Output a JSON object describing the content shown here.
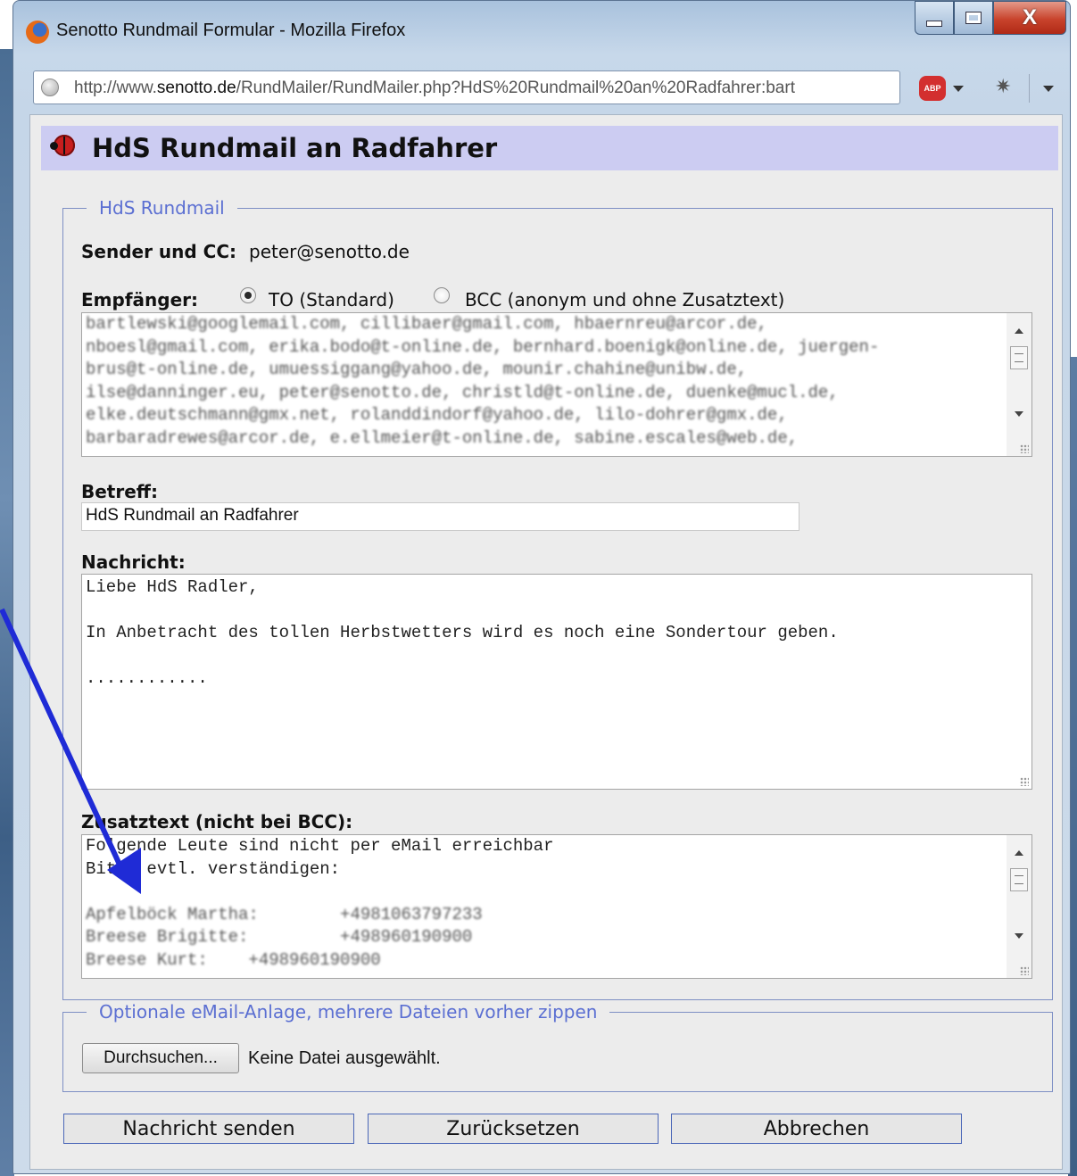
{
  "window": {
    "title": "Senotto Rundmail Formular - Mozilla Firefox",
    "close_label": "X"
  },
  "browser": {
    "url_prefix": "http://www.",
    "url_domain": "senotto.de",
    "url_rest": "/RundMailer/RundMailer.php?HdS%20Rundmail%20an%20Radfahrer:bart",
    "abp_label": "ABP"
  },
  "page": {
    "title": "HdS Rundmail an Radfahrer"
  },
  "form": {
    "legend": "HdS Rundmail",
    "sender_label": "Sender und CC:",
    "sender_value": "peter@senotto.de",
    "recipients_label": "Empfänger:",
    "radio_to_label": "TO (Standard)",
    "radio_bcc_label": "BCC (anonym und ohne Zusatztext)",
    "recipient_mode": "TO",
    "recipients_lines": [
      "bartlewski@googlemail.com, cillibaer@gmail.com, hbaernreu@arcor.de,",
      "nboesl@gmail.com, erika.bodo@t-online.de, bernhard.boenigk@online.de, juergen-",
      "brus@t-online.de, umuessiggang@yahoo.de, mounir.chahine@unibw.de,",
      "ilse@danninger.eu, peter@senotto.de, christld@t-online.de, duenke@mucl.de,",
      "elke.deutschmann@gmx.net, rolanddindorf@yahoo.de, lilo-dohrer@gmx.de,",
      "barbaradrewes@arcor.de, e.ellmeier@t-online.de, sabine.escales@web.de,"
    ],
    "subject_label": "Betreff:",
    "subject_value": "HdS Rundmail an Radfahrer",
    "message_label": "Nachricht:",
    "message_lines": [
      "Liebe HdS Radler,",
      "",
      "In Anbetracht des tollen Herbstwetters wird es noch eine Sondertour geben.",
      "",
      "............"
    ],
    "extra_label": "Zusatztext (nicht bei BCC):",
    "extra_lines": [
      "Folgende Leute sind nicht per eMail erreichbar",
      "Bitte evtl. verständigen:"
    ],
    "extra_blurred_lines": [
      "",
      "Apfelböck Martha:        +4981063797233",
      "Breese Brigitte:         +498960190900",
      "Breese Kurt:    +498960190900"
    ]
  },
  "attachment": {
    "legend": "Optionale eMail-Anlage, mehrere Dateien vorher zippen",
    "browse_label": "Durchsuchen...",
    "status": "Keine Datei ausgewählt."
  },
  "actions": {
    "send": "Nachricht senden",
    "reset": "Zurücksetzen",
    "cancel": "Abbrechen"
  },
  "colors": {
    "header_bg": "#ccccf2",
    "legend_text": "#5b6fd2",
    "annotation_arrow": "#1f2bd6"
  }
}
